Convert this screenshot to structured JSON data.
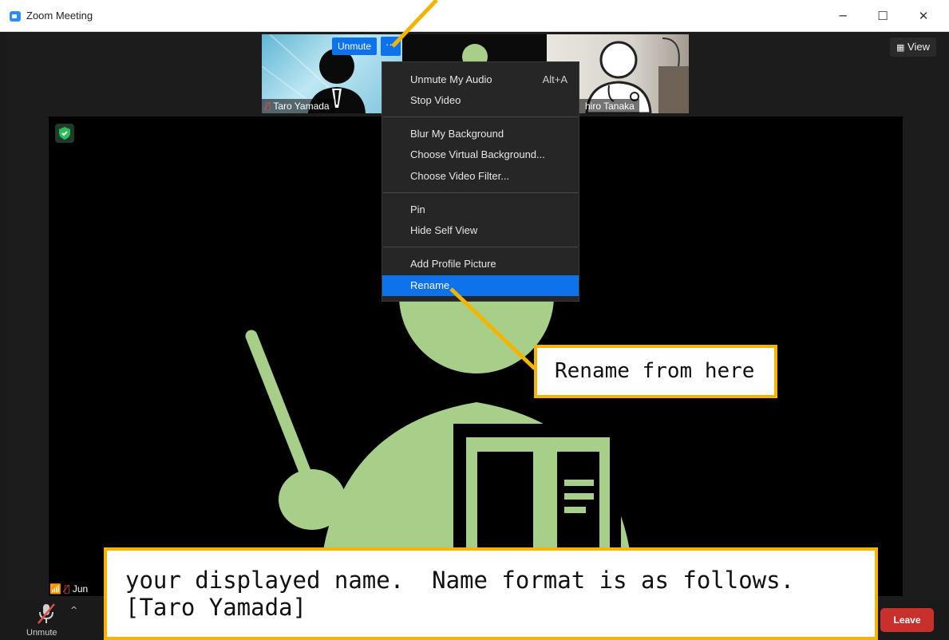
{
  "window": {
    "title": "Zoom Meeting",
    "minimize": "─",
    "maximize": "☐",
    "close": "✕"
  },
  "participants": [
    {
      "name": "Taro Yamada",
      "muted": true
    },
    {
      "name": ""
    },
    {
      "name": "hiro Tanaka"
    }
  ],
  "tile_overlay": {
    "unmute": "Unmute",
    "more": "···"
  },
  "view_button": "View",
  "self_name_partial": "Jun",
  "menu": {
    "items": [
      {
        "label": "Unmute My Audio",
        "shortcut": "Alt+A"
      },
      {
        "label": "Stop Video",
        "shortcut": ""
      },
      {
        "label": "Blur My Background",
        "shortcut": ""
      },
      {
        "label": "Choose Virtual Background...",
        "shortcut": ""
      },
      {
        "label": "Choose Video Filter...",
        "shortcut": ""
      },
      {
        "label": "Pin",
        "shortcut": ""
      },
      {
        "label": "Hide Self View",
        "shortcut": ""
      },
      {
        "label": "Add Profile Picture",
        "shortcut": ""
      },
      {
        "label": "Rename",
        "shortcut": "",
        "selected": true
      }
    ]
  },
  "callouts": {
    "rename": "Rename from here",
    "name_format": "your displayed name.  Name format is as follows.\n[Taro Yamada]"
  },
  "bottom": {
    "unmute_label": "Unmute",
    "leave_label": "Leave"
  },
  "colors": {
    "accent": "#0e72ed",
    "callout_border": "#f5b400",
    "avatar_green": "#a8cf8a",
    "leave_red": "#c8302c"
  }
}
